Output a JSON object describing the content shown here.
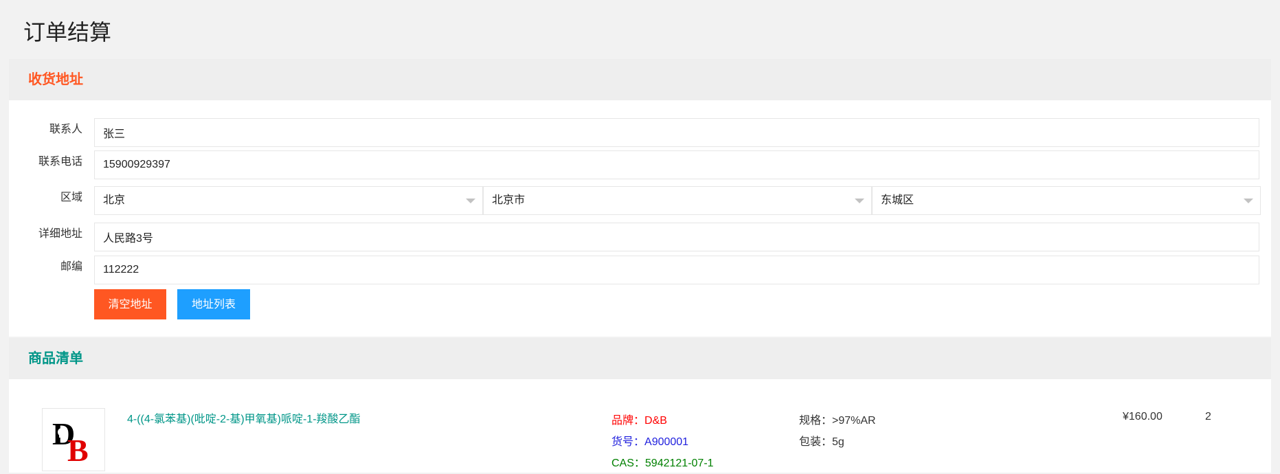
{
  "page": {
    "title": "订单结算"
  },
  "address": {
    "header": "收货地址",
    "contact": {
      "label": "联系人",
      "value": "张三"
    },
    "phone": {
      "label": "联系电话",
      "value": "15900929397"
    },
    "region": {
      "label": "区域",
      "province": "北京",
      "city": "北京市",
      "district": "东城区"
    },
    "detail": {
      "label": "详细地址",
      "value": "人民路3号"
    },
    "postcode": {
      "label": "邮编",
      "value": "112222"
    },
    "clear_button": "清空地址",
    "list_button": "地址列表"
  },
  "goods": {
    "header": "商品清单",
    "items": [
      {
        "logo_text": "DB",
        "name": "4-((4-氯苯基)(吡啶-2-基)甲氧基)哌啶-1-羧酸乙酯",
        "brand_label": "品牌：",
        "brand": "D&B",
        "itemno_label": "货号：",
        "itemno": "A900001",
        "cas_label": "CAS：",
        "cas": "5942121-07-1",
        "spec_label": "规格：",
        "spec": ">97%AR",
        "pack_label": "包装：",
        "pack": "5g",
        "price": "¥160.00",
        "qty": "2"
      }
    ]
  },
  "colors": {
    "accent_orange": "#ff5722",
    "accent_green": "#009688",
    "button_blue": "#1e9fff",
    "brand_red": "#ff0000",
    "itemno_blue": "#1e1edd",
    "cas_green": "#008000"
  }
}
